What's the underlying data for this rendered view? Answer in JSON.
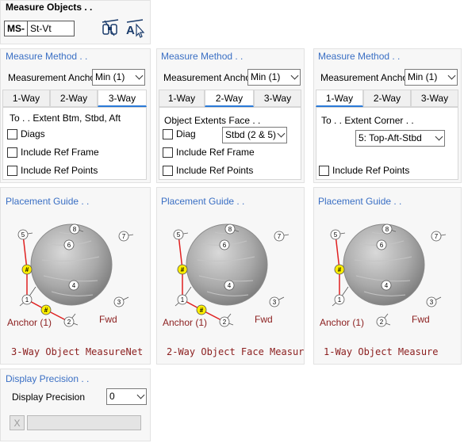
{
  "header": {
    "title": "Measure Objects . .",
    "prefix": "MS-",
    "name_value": "St-Vt",
    "tool1_icon": "binoculars-icon",
    "tool2_icon": "text-select-icon"
  },
  "columns": [
    {
      "method_title": "Measure Method . .",
      "anchor_label": "Measurement Anchor",
      "anchor_value": "Min (1)",
      "tabs": [
        "1-Way",
        "2-Way",
        "3-Way"
      ],
      "active_tab": 2,
      "to_label": "To . .  Extent Btm, Stbd, Aft",
      "checks": [
        "Diags",
        "Include Ref Frame",
        "Include Ref Points"
      ],
      "guide_title": "Placement Guide . .",
      "anchor_text": "Anchor (1)",
      "fwd_text": "Fwd",
      "caption": "3-Way Object MeasureNet"
    },
    {
      "method_title": "Measure Method . .",
      "anchor_label": "Measurement Anchor",
      "anchor_value": "Min (1)",
      "tabs": [
        "1-Way",
        "2-Way",
        "3-Way"
      ],
      "active_tab": 1,
      "face_label": "Object Extents Face . .",
      "diag_label": "Diag",
      "face_value": "Stbd (2 & 5)",
      "checks": [
        "Include Ref Frame",
        "Include Ref Points"
      ],
      "guide_title": "Placement Guide . .",
      "anchor_text": "Anchor (1)",
      "fwd_text": "Fwd",
      "caption": "2-Way Object Face Measur"
    },
    {
      "method_title": "Measure Method . .",
      "anchor_label": "Measurement Anchor",
      "anchor_value": "Min (1)",
      "tabs": [
        "1-Way",
        "2-Way",
        "3-Way"
      ],
      "active_tab": 0,
      "corner_label": "To . .  Extent Corner . .",
      "corner_value": "5: Top-Aft-Stbd",
      "checks": [
        "Include Ref Points"
      ],
      "guide_title": "Placement Guide . .",
      "anchor_text": "Anchor (1)",
      "fwd_text": "Fwd",
      "caption": "1-Way Object Measure"
    }
  ],
  "guide": {
    "nodes": [
      "1",
      "2",
      "3",
      "4",
      "5",
      "6",
      "7",
      "8"
    ],
    "marker": "#"
  },
  "precision": {
    "title": "Display Precision . .",
    "label": "Display Precision",
    "value": "0",
    "clear_label": "X"
  },
  "colors": {
    "section_title": "#3a6fc4",
    "caption": "#8b1e1e",
    "anchor_line": "#e02020",
    "marker": "#ffee00"
  }
}
